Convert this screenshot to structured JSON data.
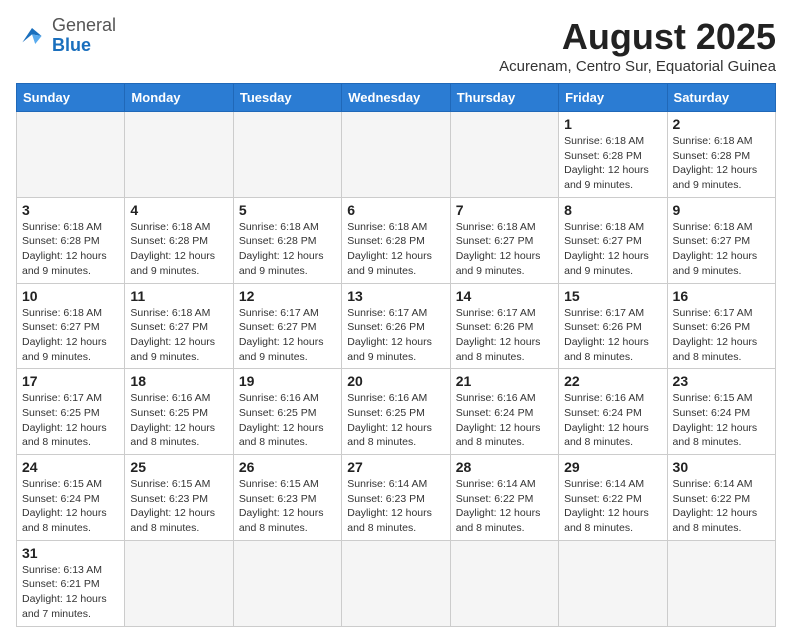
{
  "header": {
    "logo_general": "General",
    "logo_blue": "Blue",
    "month_title": "August 2025",
    "location": "Acurenam, Centro Sur, Equatorial Guinea"
  },
  "weekdays": [
    "Sunday",
    "Monday",
    "Tuesday",
    "Wednesday",
    "Thursday",
    "Friday",
    "Saturday"
  ],
  "weeks": [
    [
      {
        "day": "",
        "info": ""
      },
      {
        "day": "",
        "info": ""
      },
      {
        "day": "",
        "info": ""
      },
      {
        "day": "",
        "info": ""
      },
      {
        "day": "",
        "info": ""
      },
      {
        "day": "1",
        "info": "Sunrise: 6:18 AM\nSunset: 6:28 PM\nDaylight: 12 hours and 9 minutes."
      },
      {
        "day": "2",
        "info": "Sunrise: 6:18 AM\nSunset: 6:28 PM\nDaylight: 12 hours and 9 minutes."
      }
    ],
    [
      {
        "day": "3",
        "info": "Sunrise: 6:18 AM\nSunset: 6:28 PM\nDaylight: 12 hours and 9 minutes."
      },
      {
        "day": "4",
        "info": "Sunrise: 6:18 AM\nSunset: 6:28 PM\nDaylight: 12 hours and 9 minutes."
      },
      {
        "day": "5",
        "info": "Sunrise: 6:18 AM\nSunset: 6:28 PM\nDaylight: 12 hours and 9 minutes."
      },
      {
        "day": "6",
        "info": "Sunrise: 6:18 AM\nSunset: 6:28 PM\nDaylight: 12 hours and 9 minutes."
      },
      {
        "day": "7",
        "info": "Sunrise: 6:18 AM\nSunset: 6:27 PM\nDaylight: 12 hours and 9 minutes."
      },
      {
        "day": "8",
        "info": "Sunrise: 6:18 AM\nSunset: 6:27 PM\nDaylight: 12 hours and 9 minutes."
      },
      {
        "day": "9",
        "info": "Sunrise: 6:18 AM\nSunset: 6:27 PM\nDaylight: 12 hours and 9 minutes."
      }
    ],
    [
      {
        "day": "10",
        "info": "Sunrise: 6:18 AM\nSunset: 6:27 PM\nDaylight: 12 hours and 9 minutes."
      },
      {
        "day": "11",
        "info": "Sunrise: 6:18 AM\nSunset: 6:27 PM\nDaylight: 12 hours and 9 minutes."
      },
      {
        "day": "12",
        "info": "Sunrise: 6:17 AM\nSunset: 6:27 PM\nDaylight: 12 hours and 9 minutes."
      },
      {
        "day": "13",
        "info": "Sunrise: 6:17 AM\nSunset: 6:26 PM\nDaylight: 12 hours and 9 minutes."
      },
      {
        "day": "14",
        "info": "Sunrise: 6:17 AM\nSunset: 6:26 PM\nDaylight: 12 hours and 8 minutes."
      },
      {
        "day": "15",
        "info": "Sunrise: 6:17 AM\nSunset: 6:26 PM\nDaylight: 12 hours and 8 minutes."
      },
      {
        "day": "16",
        "info": "Sunrise: 6:17 AM\nSunset: 6:26 PM\nDaylight: 12 hours and 8 minutes."
      }
    ],
    [
      {
        "day": "17",
        "info": "Sunrise: 6:17 AM\nSunset: 6:25 PM\nDaylight: 12 hours and 8 minutes."
      },
      {
        "day": "18",
        "info": "Sunrise: 6:16 AM\nSunset: 6:25 PM\nDaylight: 12 hours and 8 minutes."
      },
      {
        "day": "19",
        "info": "Sunrise: 6:16 AM\nSunset: 6:25 PM\nDaylight: 12 hours and 8 minutes."
      },
      {
        "day": "20",
        "info": "Sunrise: 6:16 AM\nSunset: 6:25 PM\nDaylight: 12 hours and 8 minutes."
      },
      {
        "day": "21",
        "info": "Sunrise: 6:16 AM\nSunset: 6:24 PM\nDaylight: 12 hours and 8 minutes."
      },
      {
        "day": "22",
        "info": "Sunrise: 6:16 AM\nSunset: 6:24 PM\nDaylight: 12 hours and 8 minutes."
      },
      {
        "day": "23",
        "info": "Sunrise: 6:15 AM\nSunset: 6:24 PM\nDaylight: 12 hours and 8 minutes."
      }
    ],
    [
      {
        "day": "24",
        "info": "Sunrise: 6:15 AM\nSunset: 6:24 PM\nDaylight: 12 hours and 8 minutes."
      },
      {
        "day": "25",
        "info": "Sunrise: 6:15 AM\nSunset: 6:23 PM\nDaylight: 12 hours and 8 minutes."
      },
      {
        "day": "26",
        "info": "Sunrise: 6:15 AM\nSunset: 6:23 PM\nDaylight: 12 hours and 8 minutes."
      },
      {
        "day": "27",
        "info": "Sunrise: 6:14 AM\nSunset: 6:23 PM\nDaylight: 12 hours and 8 minutes."
      },
      {
        "day": "28",
        "info": "Sunrise: 6:14 AM\nSunset: 6:22 PM\nDaylight: 12 hours and 8 minutes."
      },
      {
        "day": "29",
        "info": "Sunrise: 6:14 AM\nSunset: 6:22 PM\nDaylight: 12 hours and 8 minutes."
      },
      {
        "day": "30",
        "info": "Sunrise: 6:14 AM\nSunset: 6:22 PM\nDaylight: 12 hours and 8 minutes."
      }
    ],
    [
      {
        "day": "31",
        "info": "Sunrise: 6:13 AM\nSunset: 6:21 PM\nDaylight: 12 hours and 7 minutes."
      },
      {
        "day": "",
        "info": ""
      },
      {
        "day": "",
        "info": ""
      },
      {
        "day": "",
        "info": ""
      },
      {
        "day": "",
        "info": ""
      },
      {
        "day": "",
        "info": ""
      },
      {
        "day": "",
        "info": ""
      }
    ]
  ]
}
